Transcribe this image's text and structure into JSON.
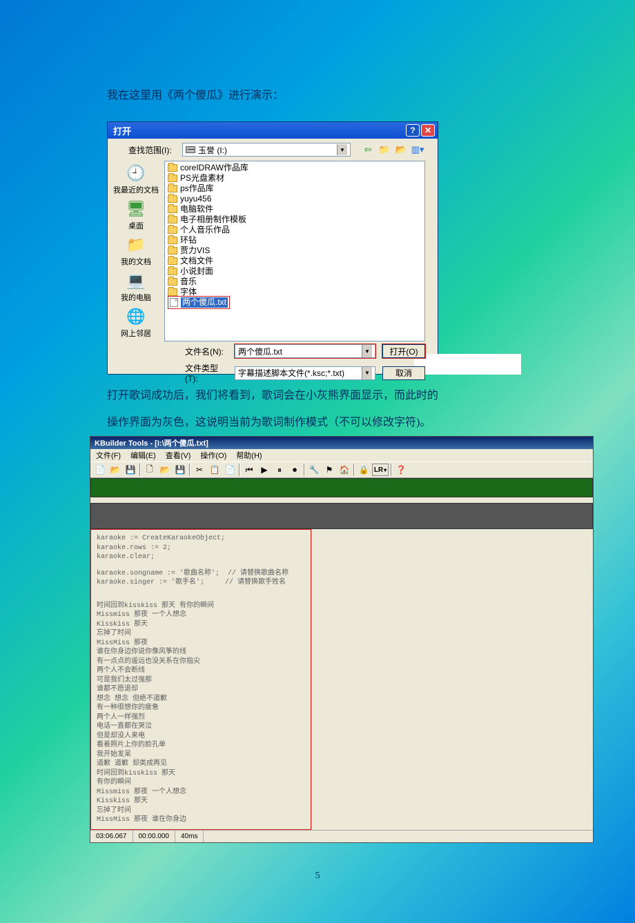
{
  "page": {
    "intro": "我在这里用《两个傻瓜》进行演示：",
    "after1": "打开歌词成功后，我们将看到，歌词会在小灰熊界面显示，而此时的",
    "after2": "操作界面为灰色，这说明当前为歌词制作模式（不可以修改字符)。",
    "number": "5"
  },
  "open": {
    "title": "打开",
    "lookin_label": "查找范围(I):",
    "drive_text": "玉誉 (I:)",
    "places": {
      "recent": "我最近的文档",
      "desktop": "桌面",
      "mydoc": "我的文档",
      "mycomp": "我的电脑",
      "net": "网上邻居"
    },
    "folders": [
      "coreIDRAW作品库",
      "PS光盘素材",
      "ps作品库",
      "yuyu456",
      "电脑软件",
      "电子相册制作模板",
      "个人音乐作品",
      "环钻",
      "贾力VIS",
      "文档文件",
      "小说封面",
      "音乐",
      "字体"
    ],
    "selected_file": "两个傻瓜.txt",
    "filename_label": "文件名(N):",
    "filename_value": "两个傻瓜.txt",
    "filetype_label": "文件类型(T):",
    "filetype_value": "字幕描述脚本文件(*.ksc;*.txt)",
    "open_btn": "打开(O)",
    "cancel_btn": "取消"
  },
  "kb": {
    "title": "KBuilder Tools - [I:\\两个傻瓜.txt]",
    "menu": {
      "file": "文件(F)",
      "edit": "编辑(E)",
      "view": "查看(V)",
      "op": "操作(O)",
      "help": "帮助(H)"
    },
    "lr": "LR",
    "status": {
      "t1": "03:06.067",
      "t2": "00:00.000",
      "ms": "40ms"
    },
    "script1": "karaoke := CreateKaraokeObject;",
    "script2": "karaoke.rows := 2;",
    "script3": "karaoke.clear;",
    "script4": "karaoke.songname := '歌曲名称';  // 请替换歌曲名称",
    "script5": "karaoke.singer := '歌手名';     // 请替换歌手姓名",
    "l01": "时间回到kisskiss 那天 有你的瞬间",
    "l02": "Missmiss 那夜 一个人想念",
    "l03": "Kisskiss 那天",
    "l04": "忘掉了时间",
    "l05": "MissMiss 那夜",
    "l06": "谁在你身边你说你像风筝的线",
    "l07": "有一点点的遥远也没关系在你指尖",
    "l08": "两个人不会断线",
    "l09": "可是我们太过强那",
    "l10": "谁都不愿退却",
    "l11": "想念 想念 但绝不道歉",
    "l12": "有一种很想你的疲惫",
    "l13": "两个人一样强烈",
    "l14": "电话一直都在哭泣",
    "l15": "但是却没人来电",
    "l16": "看着照片上你的脸孔单",
    "l17": "我开始发呆",
    "l18": "道歉 道歉 却类成再见",
    "l19": "时间回到kisskiss 那天",
    "l20": "有你的瞬间",
    "l21": "Missmiss 那夜 一个人想念",
    "l22": "Kisskiss 那天",
    "l23": "忘掉了时间",
    "l24": "MissMiss 那夜 谁在你身边"
  }
}
